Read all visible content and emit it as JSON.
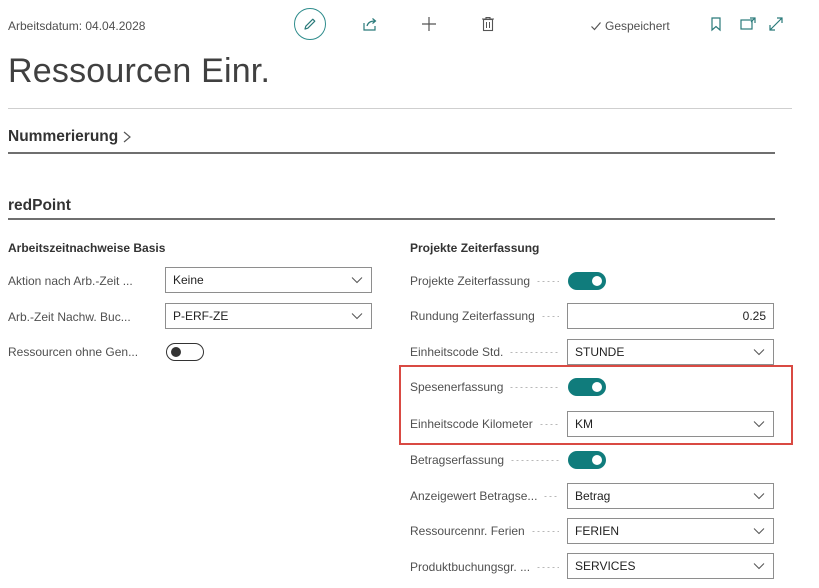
{
  "header": {
    "work_date": "Arbeitsdatum: 04.04.2028",
    "saved_status": "Gespeichert",
    "page_title": "Ressourcen Einr."
  },
  "sections": {
    "numbering": {
      "title": "Nummerierung"
    },
    "redpoint": {
      "title": "redPoint"
    }
  },
  "left_group": {
    "title": "Arbeitszeitnachweise Basis",
    "fields": [
      {
        "label": "Aktion nach Arb.-Zeit ...",
        "value": "Keine"
      },
      {
        "label": "Arb.-Zeit Nachw. Buc...",
        "value": "P-ERF-ZE"
      },
      {
        "label": "Ressourcen ohne Gen...",
        "toggle": false
      }
    ]
  },
  "right_group": {
    "title": "Projekte Zeiterfassung",
    "fields": [
      {
        "label": "Projekte Zeiterfassung",
        "toggle": true
      },
      {
        "label": "Rundung Zeiterfassung",
        "value": "0.25"
      },
      {
        "label": "Einheitscode Std.",
        "value": "STUNDE"
      },
      {
        "label": "Spesenerfassung",
        "toggle": true
      },
      {
        "label": "Einheitscode Kilometer",
        "value": "KM"
      },
      {
        "label": "Betragserfassung",
        "toggle": true
      },
      {
        "label": "Anzeigewert Betragse...",
        "value": "Betrag"
      },
      {
        "label": "Ressourcennr. Ferien",
        "value": "FERIEN"
      },
      {
        "label": "Produktbuchungsgr. ...",
        "value": "SERVICES"
      }
    ]
  },
  "colors": {
    "accent": "#107c7c",
    "highlight": "#d94a43"
  }
}
